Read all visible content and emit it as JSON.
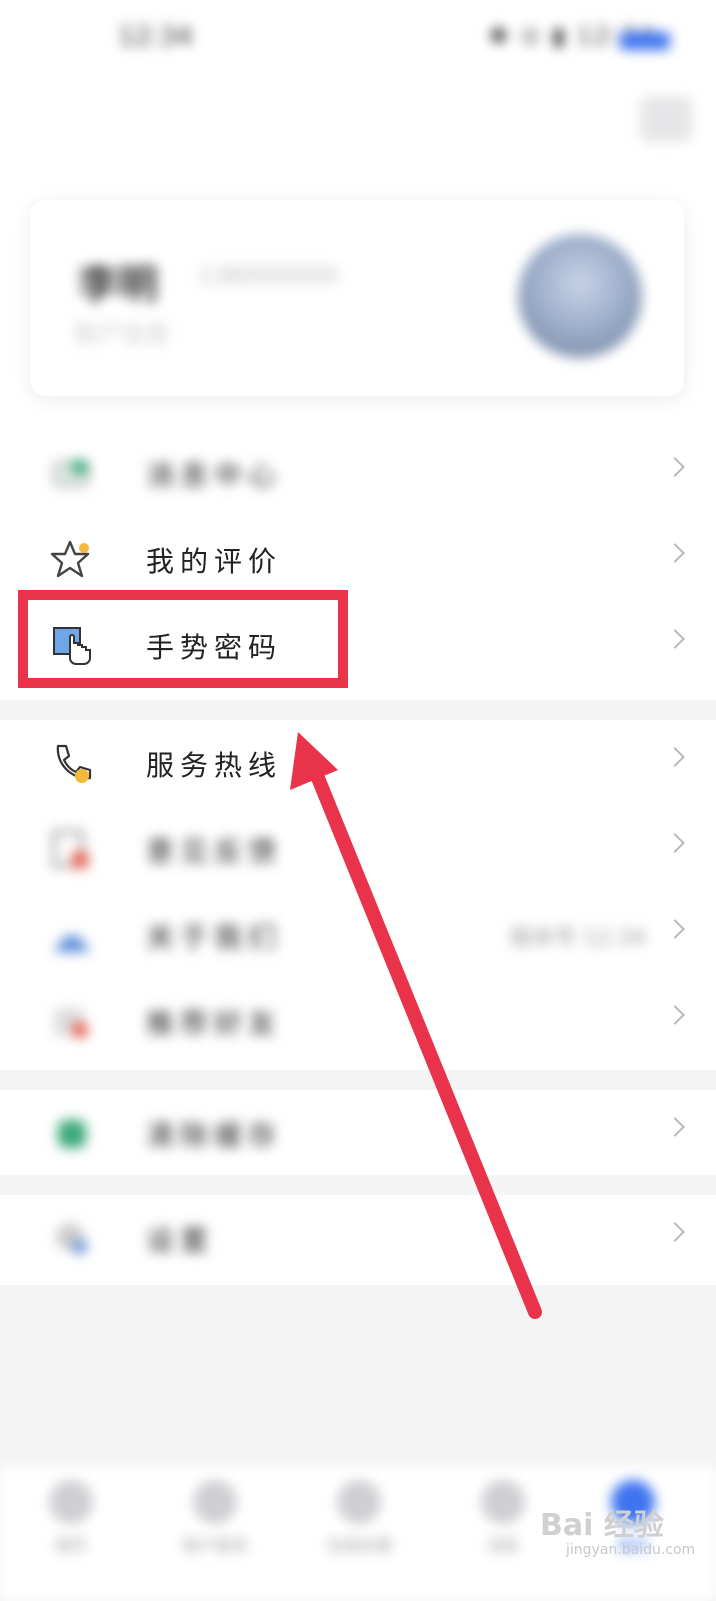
{
  "status_bar": {
    "time": "12:34",
    "icons_text": "✱ ⊙ ▮ 12:34"
  },
  "profile": {
    "name": "李明",
    "phone": "1380000000",
    "subtitle": "账户信息"
  },
  "menu_main": [
    {
      "label": "消息中心",
      "icon": "message-icon",
      "blurred": true
    },
    {
      "label": "我的评价",
      "icon": "star-icon",
      "blurred": false
    },
    {
      "label": "手势密码",
      "icon": "gesture-icon",
      "blurred": false,
      "highlighted": true
    }
  ],
  "menu_secondary": [
    {
      "label": "服务热线",
      "icon": "phone-icon",
      "blurred": false
    },
    {
      "label": "意见反馈",
      "icon": "feedback-icon",
      "blurred": true
    },
    {
      "label": "关于我们",
      "icon": "user-icon",
      "blurred": true,
      "value": "版本号 12.34"
    },
    {
      "label": "推荐好友",
      "icon": "share-icon",
      "blurred": true
    }
  ],
  "menu_third": [
    {
      "label": "清除缓存",
      "icon": "clean-icon",
      "blurred": true
    }
  ],
  "menu_fourth": [
    {
      "label": "设置",
      "icon": "settings-icon",
      "blurred": true
    }
  ],
  "bottom_nav": [
    {
      "label": "首页",
      "icon": "home-icon"
    },
    {
      "label": "账户查询",
      "icon": "search-icon"
    },
    {
      "label": "在线办理",
      "icon": "service-icon"
    },
    {
      "label": "消息",
      "icon": "message-icon"
    },
    {
      "label": "我的",
      "icon": "user-icon",
      "active": true
    }
  ],
  "watermark": {
    "text": "Bai 经验",
    "sub": "jingyan.baidu.com"
  },
  "colors": {
    "highlight": "#e8334a",
    "arrow": "#e8334a",
    "accent": "#3f74f0"
  }
}
